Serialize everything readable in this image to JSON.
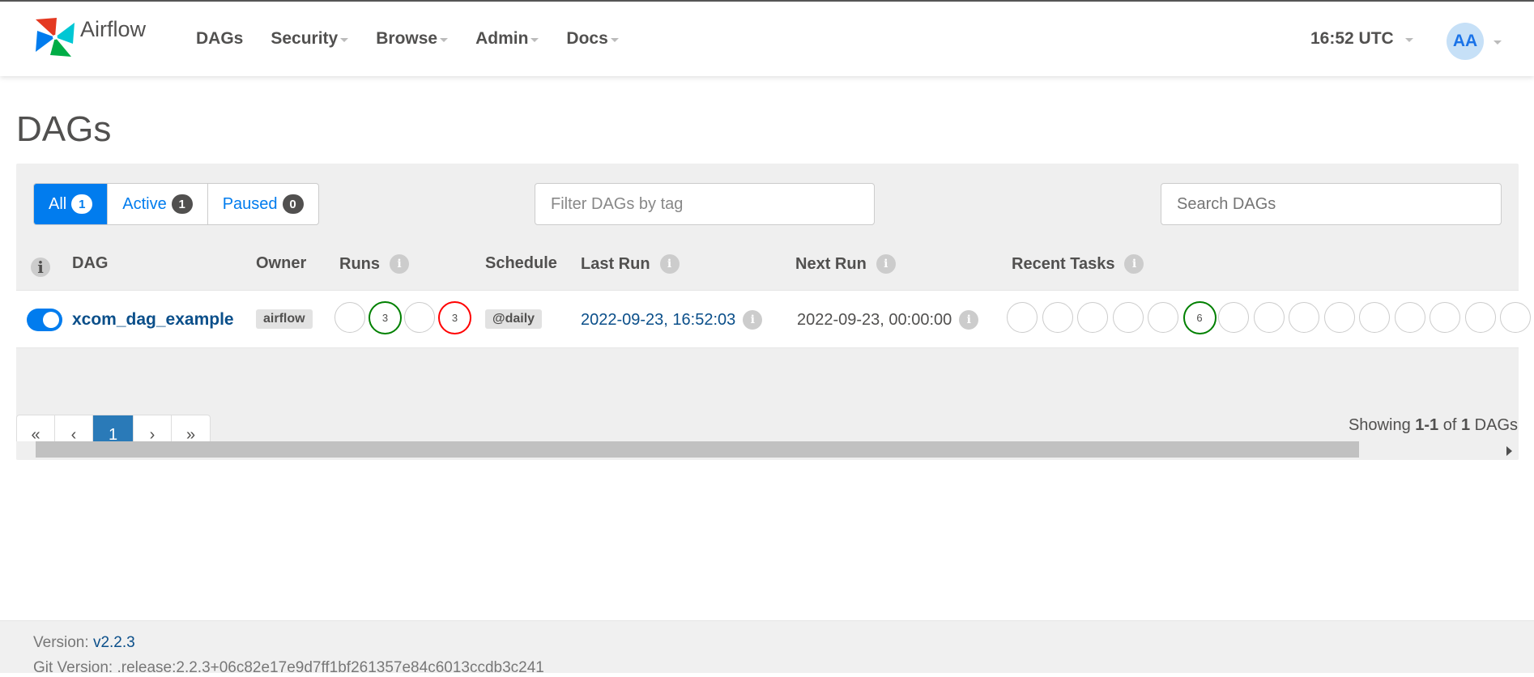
{
  "app": {
    "name": "Airflow",
    "nav": [
      "DAGs",
      "Security",
      "Browse",
      "Admin",
      "Docs"
    ],
    "clock": "16:52 UTC",
    "user_initials": "AA"
  },
  "page_title": "DAGs",
  "filters": {
    "status_buttons": [
      {
        "label": "All",
        "count": "1"
      },
      {
        "label": "Active",
        "count": "1"
      },
      {
        "label": "Paused",
        "count": "0"
      }
    ],
    "tag_placeholder": "Filter DAGs by tag",
    "search_placeholder": "Search DAGs"
  },
  "table": {
    "headers": [
      "DAG",
      "Owner",
      "Runs",
      "Schedule",
      "Last Run",
      "Next Run",
      "Recent Tasks"
    ],
    "rows": [
      {
        "active": true,
        "dag": "xcom_dag_example",
        "owner": "airflow",
        "runs": [
          "",
          "3",
          "",
          "3"
        ],
        "schedule": "@daily",
        "last_run": "2022-09-23, 16:52:03",
        "next_run": "2022-09-23, 00:00:00",
        "recent_tasks": [
          "",
          "",
          "",
          "",
          "",
          "6",
          "",
          "",
          "",
          "",
          "",
          "",
          "",
          "",
          ""
        ]
      }
    ]
  },
  "pagination": {
    "first": "«",
    "prev": "‹",
    "current": "1",
    "next": "›",
    "last": "»"
  },
  "showing": {
    "prefix": "Showing",
    "range": "1-1",
    "of": "of",
    "total": "1",
    "suffix": "DAGs"
  },
  "footer": {
    "version_label": "Version:",
    "version": "v2.2.3",
    "git_version_label": "Git Version:",
    "git_version": ".release:2.2.3+06c82e17e9d7ff1bf261357e84c6013ccdb3c241"
  },
  "colors": {
    "accent": "#017cee",
    "success": "#008000",
    "failed": "#ff0000",
    "link": "#0b4f8a"
  },
  "icons": [
    "airflow-logo-icon",
    "info-icon",
    "caret-down-icon",
    "scroll-right-arrow-icon"
  ]
}
